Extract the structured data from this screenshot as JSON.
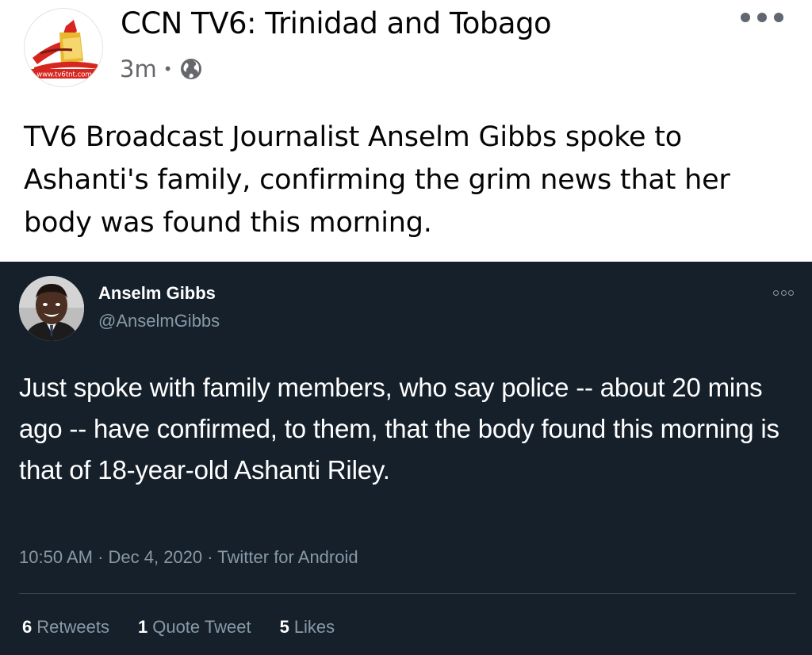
{
  "post": {
    "page_name": "CCN TV6: Trinidad and Tobago",
    "time": "3m",
    "separator": "•",
    "audience_icon": "globe-icon",
    "more_icon": "more-options-icon",
    "avatar_logo_text": "www.tv6tnt.com",
    "text": "TV6 Broadcast Journalist Anselm Gibbs spoke to Ashanti's family, confirming the grim news that her body was found this morning."
  },
  "tweet": {
    "display_name": "Anselm Gibbs",
    "handle": "@AnselmGibbs",
    "more_icon": "more-options-icon",
    "text": "Just spoke with family members, who say police -- about 20 mins ago -- have confirmed, to them, that the body found this morning is that of 18-year-old Ashanti Riley.",
    "meta": "10:50 AM · Dec 4, 2020 · Twitter for Android",
    "stats": {
      "retweets_count": "6",
      "retweets_label": "Retweets",
      "quotes_count": "1",
      "quotes_label": "Quote Tweet",
      "likes_count": "5",
      "likes_label": "Likes"
    }
  },
  "colors": {
    "fb_background": "#ffffff",
    "fb_text": "#050505",
    "fb_secondary": "#65676b",
    "tweet_background": "#15202b",
    "tweet_text": "#ffffff",
    "tweet_secondary": "#8899a6",
    "logo_red": "#d7261f"
  }
}
